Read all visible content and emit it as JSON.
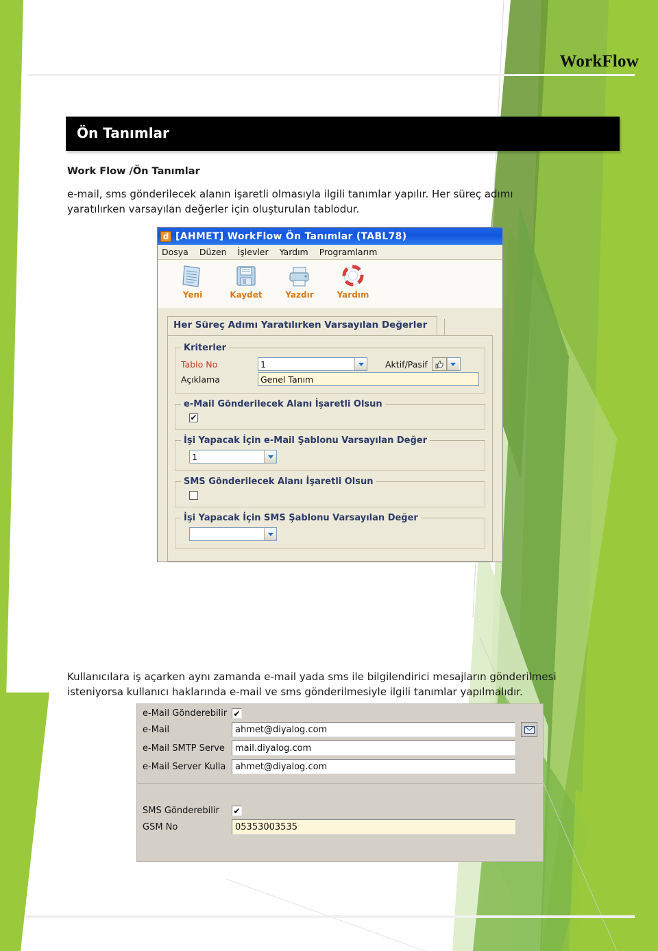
{
  "page": {
    "header_title": "WorkFlow",
    "section_title": "Ön Tanımlar",
    "breadcrumb": "Work Flow /Ön Tanımlar",
    "paragraph1": "e-mail, sms gönderilecek alanın işaretli olmasıyla ilgili tanımlar yapılır. Her süreç adımı yaratılırken varsayılan değerler için oluşturulan tablodur.",
    "paragraph2": "Kullanıcılara iş açarken aynı zamanda e-mail yada sms ile bilgilendirici mesajların gönderilmesi isteniyorsa kullanıcı haklarında e-mail ve sms gönderilmesiyle ilgili tanımlar yapılmalıdır."
  },
  "colors": {
    "green_light": "#9ACA3C",
    "green_mid": "#78A84A",
    "green_dark": "#6E9B3A",
    "green_pale": "#D8E9BC",
    "green_pale2": "#C4DF9B",
    "title_bar_blue": "#1156DD",
    "accent_orange": "#D77A12",
    "label_red": "#C0392B",
    "group_blue": "#2B3A67"
  },
  "window1": {
    "app_icon": "d",
    "title": "[AHMET] WorkFlow Ön Tanımlar (TABL78)",
    "menu": [
      "Dosya",
      "Düzen",
      "İşlevler",
      "Yardım",
      "Programlarım"
    ],
    "toolbar": [
      {
        "icon": "new-document-icon",
        "label": "Yeni"
      },
      {
        "icon": "floppy-save-icon",
        "label": "Kaydet"
      },
      {
        "icon": "printer-icon",
        "label": "Yazdır"
      },
      {
        "icon": "lifebuoy-help-icon",
        "label": "Yardım"
      }
    ],
    "tab_label": "Her Süreç Adımı Yaratılırken Varsayılan Değerler",
    "criteria": {
      "legend": "Kriterler",
      "tablo_no_label": "Tablo No",
      "tablo_no_value": "1",
      "aktif_pasif_label": "Aktif/Pasif",
      "aciklama_label": "Açıklama",
      "aciklama_value": "Genel Tanım"
    },
    "groups": [
      {
        "legend": "e-Mail Gönderilecek Alanı İşaretli Olsun",
        "type": "checkbox",
        "checked": true
      },
      {
        "legend": "İşi Yapacak İçin e-Mail Şablonu Varsayılan Değer",
        "type": "combo",
        "value": "1"
      },
      {
        "legend": "SMS Gönderilecek Alanı İşaretli Olsun",
        "type": "checkbox",
        "checked": false
      },
      {
        "legend": "İşi Yapacak İçin SMS Şablonu Varsayılan Değer",
        "type": "combo",
        "value": ""
      }
    ]
  },
  "window2": {
    "email_panel": {
      "can_send_label": "e-Mail Gönderebilir",
      "can_send_checked": true,
      "fields": [
        {
          "label": "e-Mail",
          "value": "ahmet@diyalog.com"
        },
        {
          "label": "e-Mail SMTP Serve",
          "value": "mail.diyalog.com"
        },
        {
          "label": "e-Mail Server Kulla",
          "value": "ahmet@diyalog.com"
        }
      ],
      "send_button_icon": "envelope-icon"
    },
    "sms_panel": {
      "can_send_label": "SMS Gönderebilir",
      "can_send_checked": true,
      "gsm_label": "GSM No",
      "gsm_value": "05353003535"
    }
  }
}
